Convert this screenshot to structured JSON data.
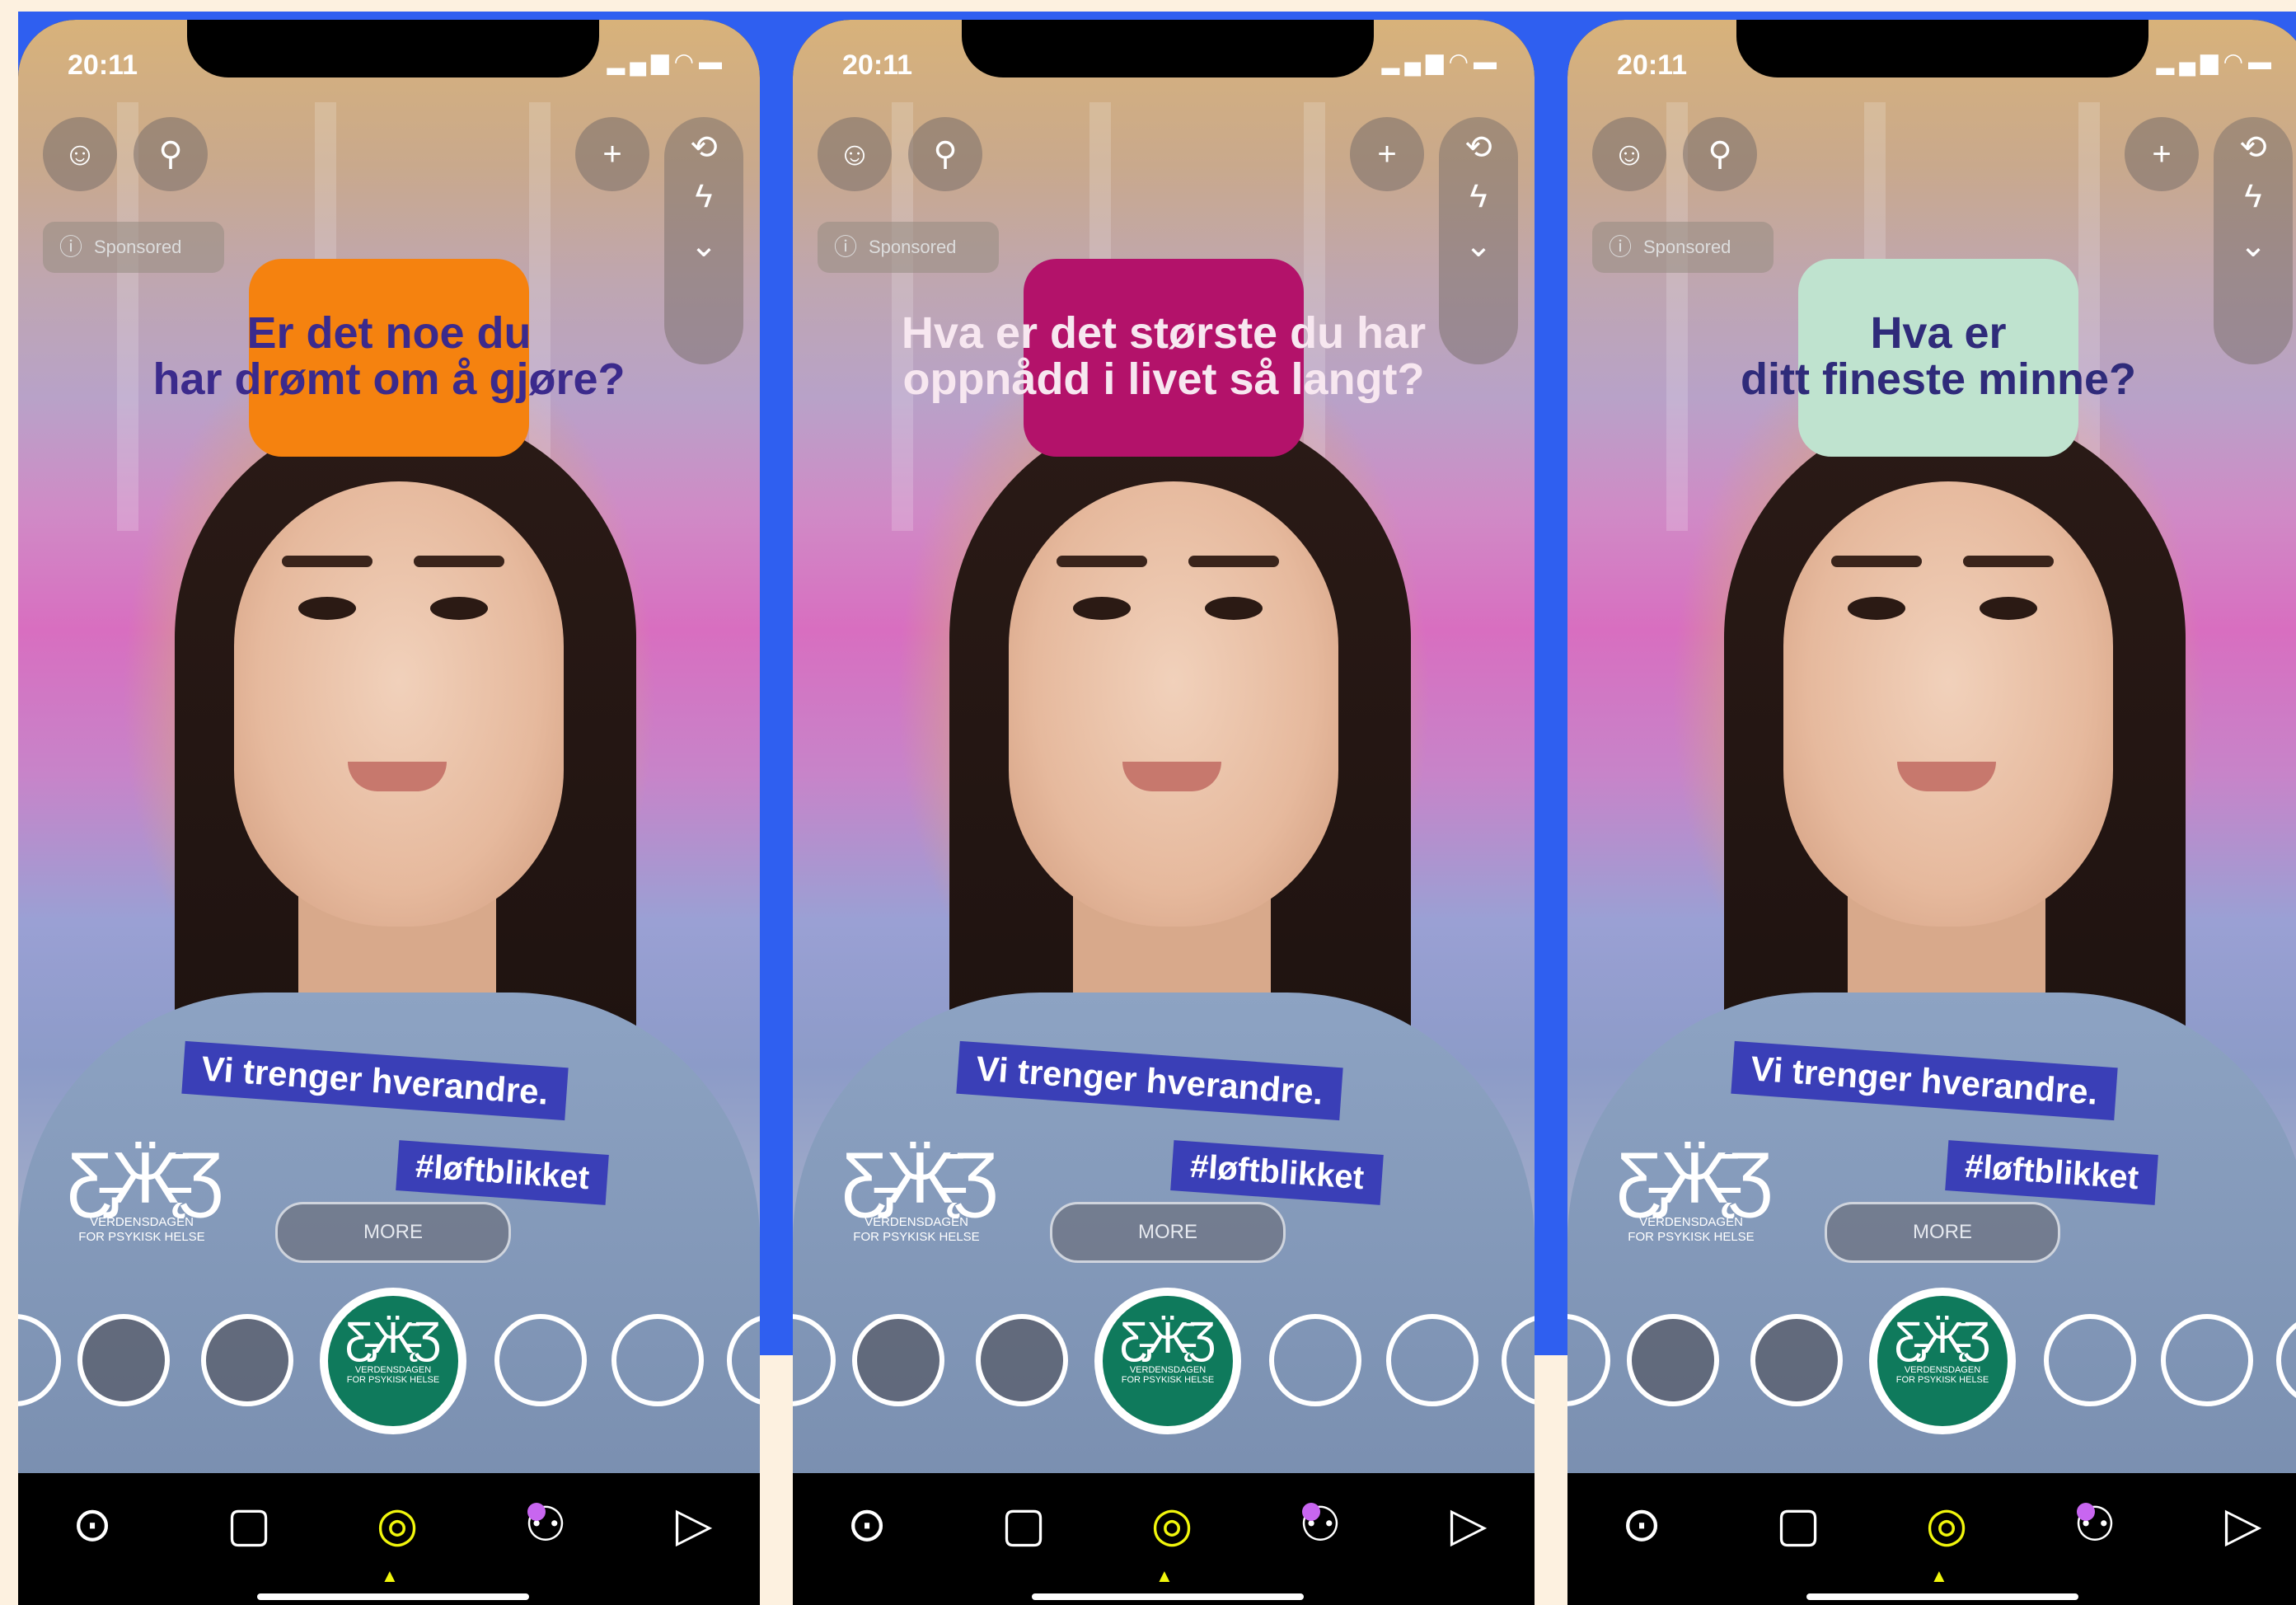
{
  "status": {
    "time": "20:11"
  },
  "sponsored_label": "Sponsored",
  "more_label": "MORE",
  "tags": {
    "line1": "Vi trenger hverandre.",
    "line2": "#løftblikket"
  },
  "logo": {
    "line1": "VERDENSDAGEN",
    "line2": "FOR PSYKISK HELSE"
  },
  "icons": {
    "ghost": "ghost-icon",
    "search": "search-icon",
    "add_friend": "add-friend-icon",
    "flip": "flip-camera-icon",
    "flash": "flash-icon",
    "more": "chevron-down-icon",
    "map": "map-icon",
    "chat": "chat-icon",
    "camera": "camera-icon",
    "friends": "friends-icon",
    "play": "play-icon"
  },
  "colors": {
    "frame": "#2f5ff0",
    "background": "#fdf1e0",
    "tag": "#3a3fb7",
    "nav_active": "#f1f60c",
    "lens": "#0f7a5c"
  },
  "phones": [
    {
      "question_line1": "Er det noe du",
      "question_line2": "har drømt om å gjøre?",
      "box_color": "#f5820f",
      "text_color": "#3b2a8c"
    },
    {
      "question_line1": "Hva er det største du har",
      "question_line2": "oppnådd i livet så langt?",
      "box_color": "#b3126a",
      "text_color": "#f7e7f0"
    },
    {
      "question_line1": "Hva er",
      "question_line2": "ditt fineste minne?",
      "box_color": "#bfe3cf",
      "text_color": "#2f2b7a"
    }
  ]
}
